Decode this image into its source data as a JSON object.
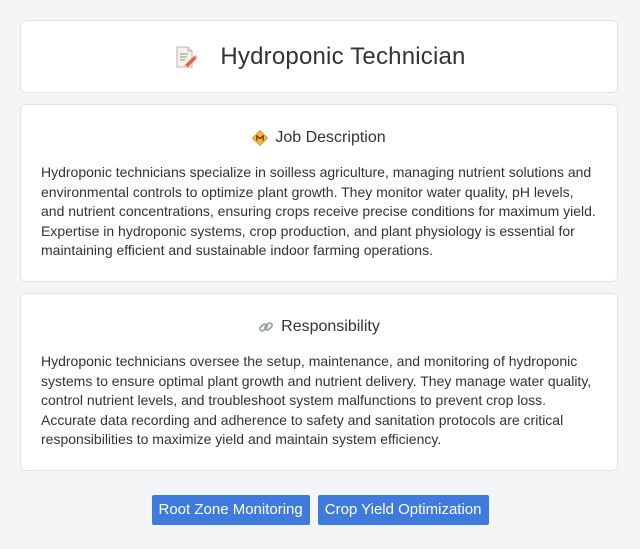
{
  "header": {
    "title": "Hydroponic Technician",
    "icon": "memo-pencil-icon"
  },
  "job_description": {
    "heading": "Job Description",
    "icon": "diamond-badge-icon",
    "text": "Hydroponic technicians specialize in soilless agriculture, managing nutrient solutions and environmental controls to optimize plant growth. They monitor water quality, pH levels, and nutrient concentrations, ensuring crops receive precise conditions for maximum yield. Expertise in hydroponic systems, crop production, and plant physiology is essential for maintaining efficient and sustainable indoor farming operations."
  },
  "responsibility": {
    "heading": "Responsibility",
    "icon": "link-icon",
    "text": "Hydroponic technicians oversee the setup, maintenance, and monitoring of hydroponic systems to ensure optimal plant growth and nutrient delivery. They manage water quality, control nutrient levels, and troubleshoot system malfunctions to prevent crop loss. Accurate data recording and adherence to safety and sanitation protocols are critical responsibilities to maximize yield and maintain system efficiency."
  },
  "tags": [
    {
      "label": "Root Zone Monitoring"
    },
    {
      "label": "Crop Yield Optimization"
    }
  ],
  "colors": {
    "background": "#f4f5f7",
    "card": "#ffffff",
    "tag": "#3f7bdc"
  }
}
